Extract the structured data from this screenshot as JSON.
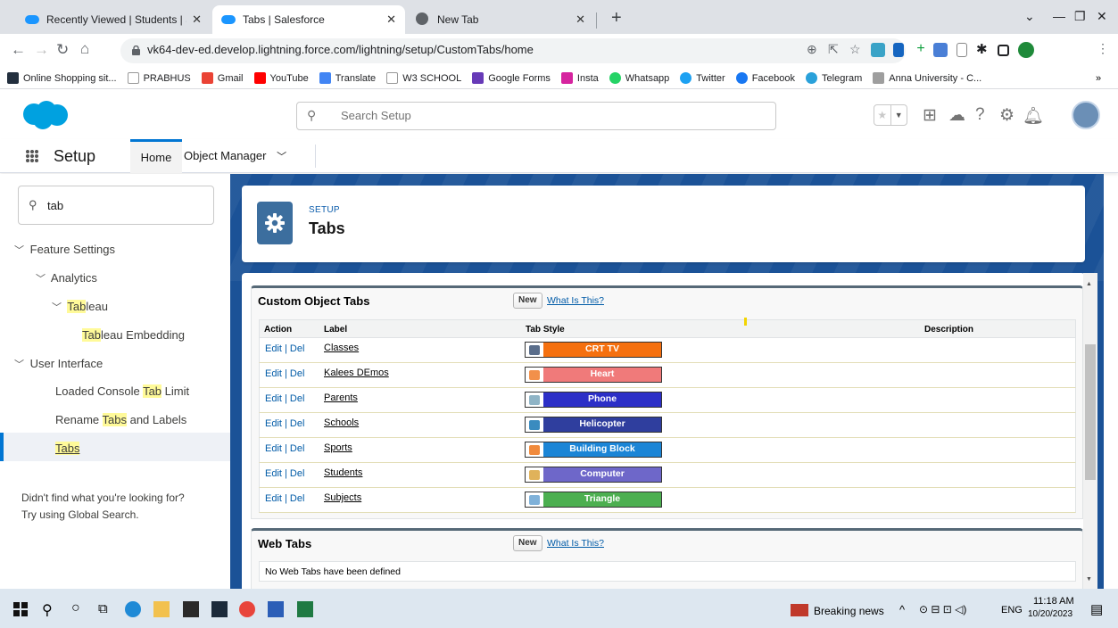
{
  "browser": {
    "tabs": [
      {
        "title": "Recently Viewed | Students | Sale",
        "active": false
      },
      {
        "title": "Tabs | Salesforce",
        "active": true
      },
      {
        "title": "New Tab",
        "active": false
      }
    ],
    "url": "vk64-dev-ed.develop.lightning.force.com/lightning/setup/CustomTabs/home",
    "bookmarks": [
      {
        "label": "Online Shopping sit...",
        "color": "#232f3e"
      },
      {
        "label": "PRABHUS",
        "color": "#ffffff"
      },
      {
        "label": "Gmail",
        "color": "#ea4335"
      },
      {
        "label": "YouTube",
        "color": "#ff0000"
      },
      {
        "label": "Translate",
        "color": "#4285f4"
      },
      {
        "label": "W3 SCHOOL",
        "color": "#ffffff"
      },
      {
        "label": "Google Forms",
        "color": "#673ab7"
      },
      {
        "label": "Insta",
        "color": "#d6249f"
      },
      {
        "label": "Whatsapp",
        "color": "#25d366"
      },
      {
        "label": "Twitter",
        "color": "#1da1f2"
      },
      {
        "label": "Facebook",
        "color": "#1877f2"
      },
      {
        "label": "Telegram",
        "color": "#2aa1da"
      },
      {
        "label": "Anna University - C...",
        "color": "#9e9e9e"
      }
    ],
    "bookmarks_more": "»"
  },
  "header": {
    "search_placeholder": "Search Setup"
  },
  "nav": {
    "app": "Setup",
    "home": "Home",
    "object_manager": "Object Manager"
  },
  "sidebar": {
    "search_value": "tab",
    "feature_settings": "Feature Settings",
    "analytics": "Analytics",
    "tableau_hl": "Tab",
    "tableau_rest": "leau",
    "tableau_emb_hl": "Tab",
    "tableau_emb_rest": "leau Embedding",
    "user_interface": "User Interface",
    "console_pre": "Loaded Console ",
    "console_hl": "Tab",
    "console_post": " Limit",
    "rename_pre": "Rename ",
    "rename_hl": "Tabs",
    "rename_post": " and Labels",
    "tabs_hl": "Tabs",
    "not_found_1": "Didn't find what you're looking for?",
    "not_found_2": "Try using Global Search."
  },
  "page": {
    "eyebrow": "SETUP",
    "title": "Tabs"
  },
  "custom_tabs": {
    "title": "Custom Object Tabs",
    "new_label": "New",
    "what_label": "What Is This?",
    "columns": [
      "Action",
      "Label",
      "Tab Style",
      "Description"
    ],
    "action_text": "Edit | Del",
    "rows": [
      {
        "label": "Classes",
        "style": "CRT TV",
        "color": "#f5700f",
        "icon": "#5a6d8a"
      },
      {
        "label": "Kalees DEmos",
        "style": "Heart",
        "color": "#f07a7a",
        "icon": "#f2904a"
      },
      {
        "label": "Parents",
        "style": "Phone",
        "color": "#2c2fc7",
        "icon": "#8fb4c6"
      },
      {
        "label": "Schools",
        "style": "Helicopter",
        "color": "#2f3e9e",
        "icon": "#3a8bbf"
      },
      {
        "label": "Sports",
        "style": "Building Block",
        "color": "#1b85d6",
        "icon": "#f08a3c"
      },
      {
        "label": "Students",
        "style": "Computer",
        "color": "#6e67c9",
        "icon": "#e0b25a"
      },
      {
        "label": "Subjects",
        "style": "Triangle",
        "color": "#4caf50",
        "icon": "#7fb1d9"
      }
    ]
  },
  "web_tabs": {
    "title": "Web Tabs",
    "new_label": "New",
    "what_label": "What Is This?",
    "empty": "No Web Tabs have been defined"
  },
  "taskbar": {
    "news": "Breaking news",
    "lang": "ENG",
    "time": "11:18 AM",
    "date": "10/20/2023"
  }
}
